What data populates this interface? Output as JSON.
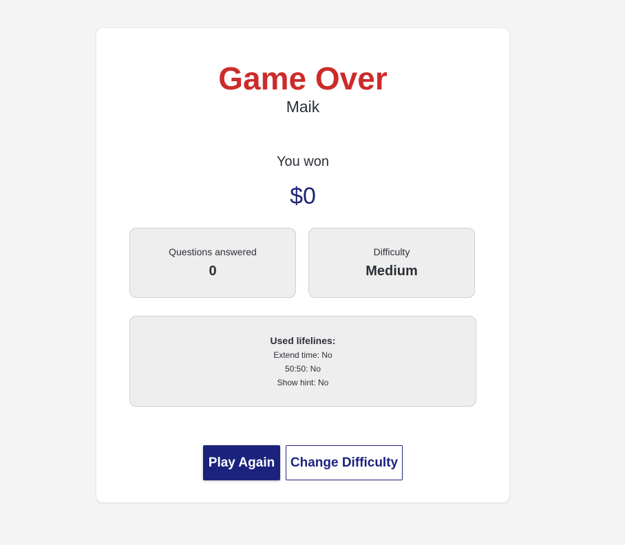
{
  "game_over": {
    "title": "Game Over",
    "player_name": "Maik",
    "won_label": "You won",
    "prize_amount": "$0"
  },
  "stats": {
    "questions_label": "Questions answered",
    "questions_value": "0",
    "difficulty_label": "Difficulty",
    "difficulty_value": "Medium"
  },
  "lifelines": {
    "title": "Used lifelines:",
    "items": [
      "Extend time: No",
      "50:50: No",
      "Show hint: No"
    ]
  },
  "actions": {
    "play_again_label": "Play Again",
    "change_difficulty_label": "Change Difficulty"
  },
  "colors": {
    "title_red": "#cc2b2b",
    "accent_navy": "#1c237d",
    "page_background": "#f4f4f4",
    "box_background": "#eeeeee"
  }
}
